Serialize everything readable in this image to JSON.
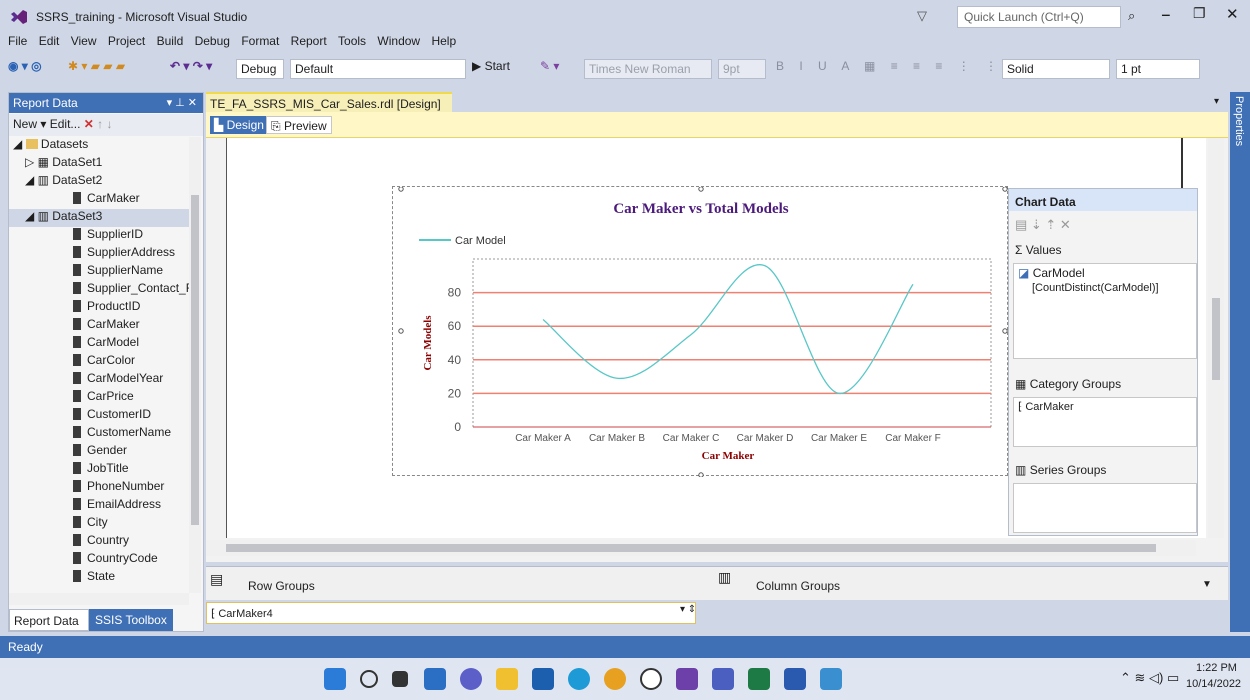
{
  "window": {
    "title": "SSRS_training - Microsoft Visual Studio",
    "quick_launch_placeholder": "Quick Launch (Ctrl+Q)"
  },
  "menu": [
    "File",
    "Edit",
    "View",
    "Project",
    "Build",
    "Debug",
    "Format",
    "Report",
    "Tools",
    "Window",
    "Help"
  ],
  "toolbar": {
    "config": "Debug",
    "platform": "Default",
    "start": "▶ Start",
    "font": "Times New Roman",
    "size": "9pt",
    "border_style": "Solid",
    "border_width": "1 pt"
  },
  "report_data": {
    "header": "Report Data",
    "toolbar_new": "New ▾",
    "toolbar_edit": "Edit...",
    "tree": {
      "datasets": "Datasets",
      "dataset1": "DataSet1",
      "dataset2": "DataSet2",
      "dataset2_fields": [
        "CarMaker"
      ],
      "dataset3": "DataSet3",
      "dataset3_fields": [
        "SupplierID",
        "SupplierAddress",
        "SupplierName",
        "Supplier_Contact_F",
        "ProductID",
        "CarMaker",
        "CarModel",
        "CarColor",
        "CarModelYear",
        "CarPrice",
        "CustomerID",
        "CustomerName",
        "Gender",
        "JobTitle",
        "PhoneNumber",
        "EmailAddress",
        "City",
        "Country",
        "CountryCode",
        "State"
      ]
    },
    "tabs": [
      "Report Data",
      "SSIS Toolbox"
    ]
  },
  "document": {
    "tab_title": "TE_FA_SSRS_MIS_Car_Sales.rdl [Design]",
    "design_tab": "Design",
    "preview_tab": "Preview",
    "properties_label": "Properties"
  },
  "chart_data": {
    "type": "line",
    "title": "Car Maker vs Total Models",
    "xlabel": "Car Maker",
    "ylabel": "Car Models",
    "categories": [
      "Car Maker A",
      "Car Maker B",
      "Car Maker C",
      "Car Maker D",
      "Car Maker E",
      "Car Maker F"
    ],
    "series": [
      {
        "name": "Car Model",
        "values": [
          64,
          29,
          55,
          96,
          20,
          85
        ],
        "color": "#58c7c7"
      }
    ],
    "ylim": [
      0,
      100
    ],
    "yticks": [
      0,
      20,
      40,
      60,
      80
    ],
    "gridline_color": "#f08070",
    "legend": "top-left",
    "smooth": true
  },
  "chart_data_panel": {
    "title": "Chart Data",
    "values_label": "Σ  Values",
    "value_series": "CarModel",
    "value_expr": "[CountDistinct(CarModel)]",
    "category_groups_label": "Category Groups",
    "category_item": "CarMaker",
    "series_groups_label": "Series Groups"
  },
  "groups": {
    "row_groups": "Row Groups",
    "column_groups": "Column Groups",
    "row_group_item": "CarMaker4"
  },
  "status": "Ready",
  "clock": {
    "time": "1:22 PM",
    "date": "10/14/2022"
  }
}
